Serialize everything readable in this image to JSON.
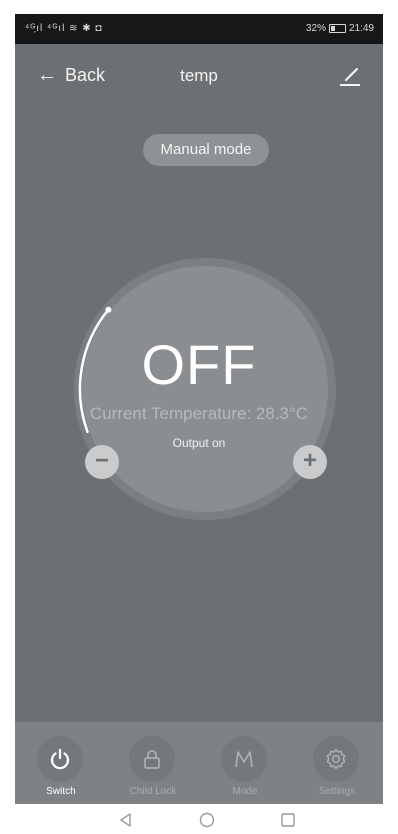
{
  "status_bar": {
    "signal": "⁴ᴳ᷊ıl ⁴ᴳıl ≋ ✱ ◘",
    "battery_percent": "32%",
    "time": "21:49"
  },
  "header": {
    "back_label": "Back",
    "title": "temp"
  },
  "mode": {
    "label": "Manual mode"
  },
  "dial": {
    "state": "OFF",
    "current_temperature": "Current Temperature: 28.3°C",
    "output_status": "Output on",
    "minus_label": "−",
    "plus_label": "+",
    "level_fraction": 0.27
  },
  "bottom_nav": {
    "items": [
      {
        "label": "Switch",
        "icon": "power-icon",
        "active": true
      },
      {
        "label": "Child Lock",
        "icon": "lock-icon",
        "active": false
      },
      {
        "label": "Mode",
        "icon": "mode-m-icon",
        "active": false
      },
      {
        "label": "Settings",
        "icon": "gear-icon",
        "active": false
      }
    ]
  },
  "colors": {
    "screen_background": "#6d7072",
    "status_bar": "#161718",
    "nav_background": "#7f8285",
    "dial_fill": "#8b8e91"
  }
}
